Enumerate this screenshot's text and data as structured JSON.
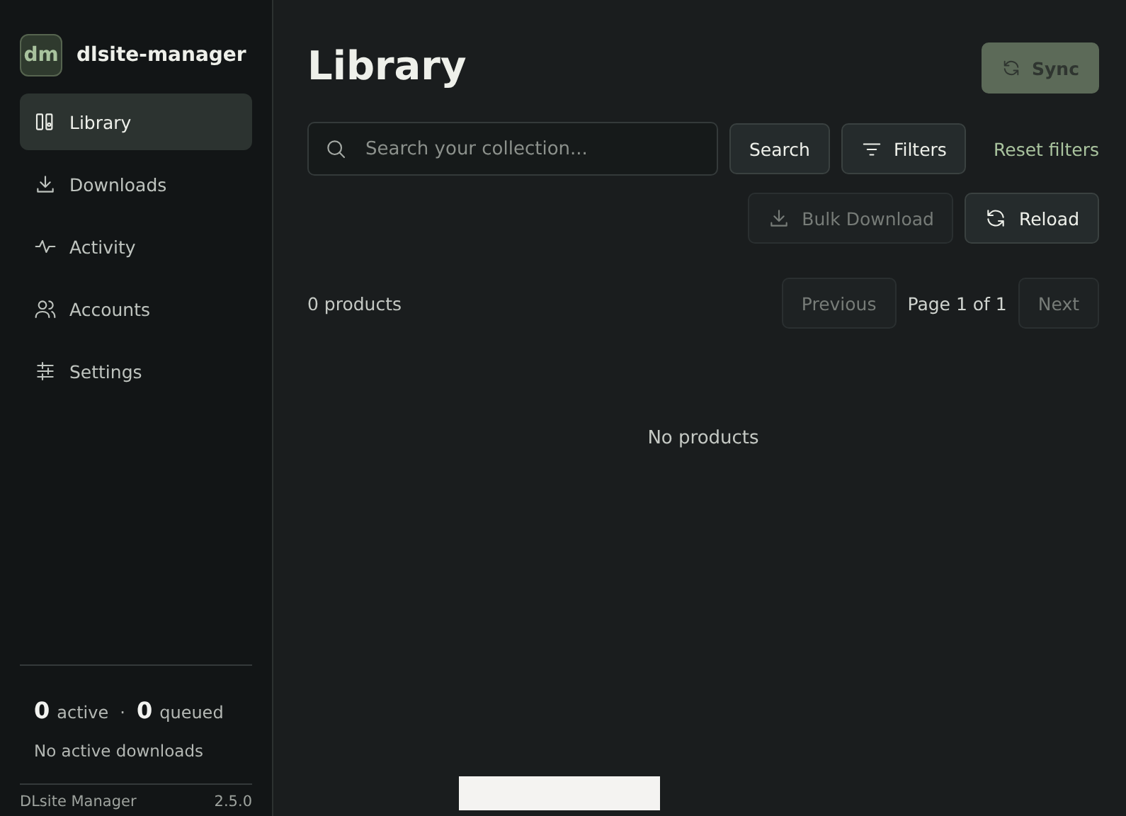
{
  "sidebar": {
    "logo": "dm",
    "app_name": "dlsite-manager",
    "items": [
      {
        "label": "Library",
        "selected": true
      },
      {
        "label": "Downloads",
        "selected": false
      },
      {
        "label": "Activity",
        "selected": false
      },
      {
        "label": "Accounts",
        "selected": false
      },
      {
        "label": "Settings",
        "selected": false
      }
    ],
    "stats": {
      "active_count": "0",
      "active_label": "active",
      "separator": "·",
      "queued_count": "0",
      "queued_label": "queued",
      "status": "No active downloads"
    },
    "footer": {
      "name": "DLsite Manager",
      "version": "2.5.0"
    }
  },
  "main": {
    "title": "Library",
    "sync_button": {
      "label": "Sync",
      "disabled": true
    },
    "search": {
      "placeholder": "Search your collection..."
    },
    "search_button": "Search",
    "filters_button": "Filters",
    "reset_link": "Reset filters",
    "bulk_download": {
      "label": "Bulk Download",
      "disabled": true
    },
    "reload": {
      "label": "Reload",
      "disabled": false
    },
    "count": "0 products",
    "pagination": {
      "previous": {
        "label": "Previous",
        "disabled": true
      },
      "page": "Page 1 of 1",
      "next": {
        "label": "Next",
        "disabled": true
      }
    },
    "empty": "No products"
  }
}
